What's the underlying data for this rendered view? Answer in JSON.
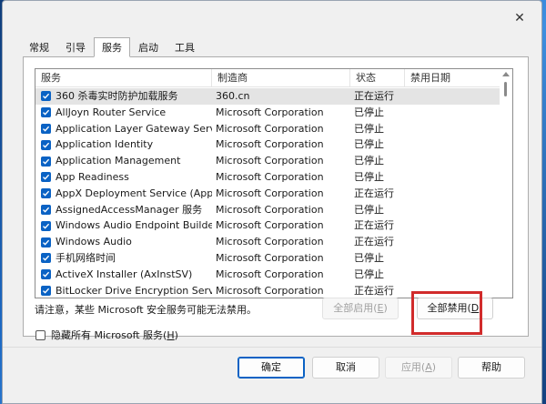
{
  "window": {
    "close_glyph": "✕"
  },
  "tabs": [
    {
      "label": "常规"
    },
    {
      "label": "引导"
    },
    {
      "label": "服务",
      "active": true
    },
    {
      "label": "启动"
    },
    {
      "label": "工具"
    }
  ],
  "services": {
    "headers": [
      "服务",
      "制造商",
      "状态",
      "禁用日期"
    ],
    "rows": [
      {
        "name": "360 杀毒实时防护加载服务",
        "maker": "360.cn",
        "status": "正在运行",
        "disabled_date": "",
        "checked": true,
        "selected": true
      },
      {
        "name": "AllJoyn Router Service",
        "maker": "Microsoft Corporation",
        "status": "已停止",
        "disabled_date": "",
        "checked": true
      },
      {
        "name": "Application Layer Gateway Service",
        "maker": "Microsoft Corporation",
        "status": "已停止",
        "disabled_date": "",
        "checked": true
      },
      {
        "name": "Application Identity",
        "maker": "Microsoft Corporation",
        "status": "已停止",
        "disabled_date": "",
        "checked": true
      },
      {
        "name": "Application Management",
        "maker": "Microsoft Corporation",
        "status": "已停止",
        "disabled_date": "",
        "checked": true
      },
      {
        "name": "App Readiness",
        "maker": "Microsoft Corporation",
        "status": "已停止",
        "disabled_date": "",
        "checked": true
      },
      {
        "name": "AppX Deployment Service (AppX...",
        "maker": "Microsoft Corporation",
        "status": "正在运行",
        "disabled_date": "",
        "checked": true
      },
      {
        "name": "AssignedAccessManager 服务",
        "maker": "Microsoft Corporation",
        "status": "已停止",
        "disabled_date": "",
        "checked": true
      },
      {
        "name": "Windows Audio Endpoint Builder",
        "maker": "Microsoft Corporation",
        "status": "正在运行",
        "disabled_date": "",
        "checked": true
      },
      {
        "name": "Windows Audio",
        "maker": "Microsoft Corporation",
        "status": "正在运行",
        "disabled_date": "",
        "checked": true
      },
      {
        "name": "手机网络时间",
        "maker": "Microsoft Corporation",
        "status": "已停止",
        "disabled_date": "",
        "checked": true
      },
      {
        "name": "ActiveX Installer (AxInstSV)",
        "maker": "Microsoft Corporation",
        "status": "已停止",
        "disabled_date": "",
        "checked": true
      },
      {
        "name": "BitLocker Drive Encryption Service",
        "maker": "Microsoft Corporation",
        "status": "正在运行",
        "disabled_date": "",
        "checked": true
      }
    ]
  },
  "note": "请注意，某些 Microsoft 安全服务可能无法禁用。",
  "buttons": {
    "enable_all": {
      "label": "全部启用(",
      "key": "E",
      "suffix": ")"
    },
    "disable_all": {
      "label": "全部禁用(",
      "key": "D",
      "suffix": ")"
    },
    "ok": "确定",
    "cancel": "取消",
    "apply": {
      "label": "应用(",
      "key": "A",
      "suffix": ")"
    },
    "help": "帮助"
  },
  "hide_ms": {
    "label": "隐藏所有 Microsoft 服务(",
    "key": "H",
    "suffix": ")",
    "checked": false
  },
  "colors": {
    "checkbox": "#0a62c4",
    "highlight": "#d12b2b",
    "primary_border": "#0a62c4"
  }
}
